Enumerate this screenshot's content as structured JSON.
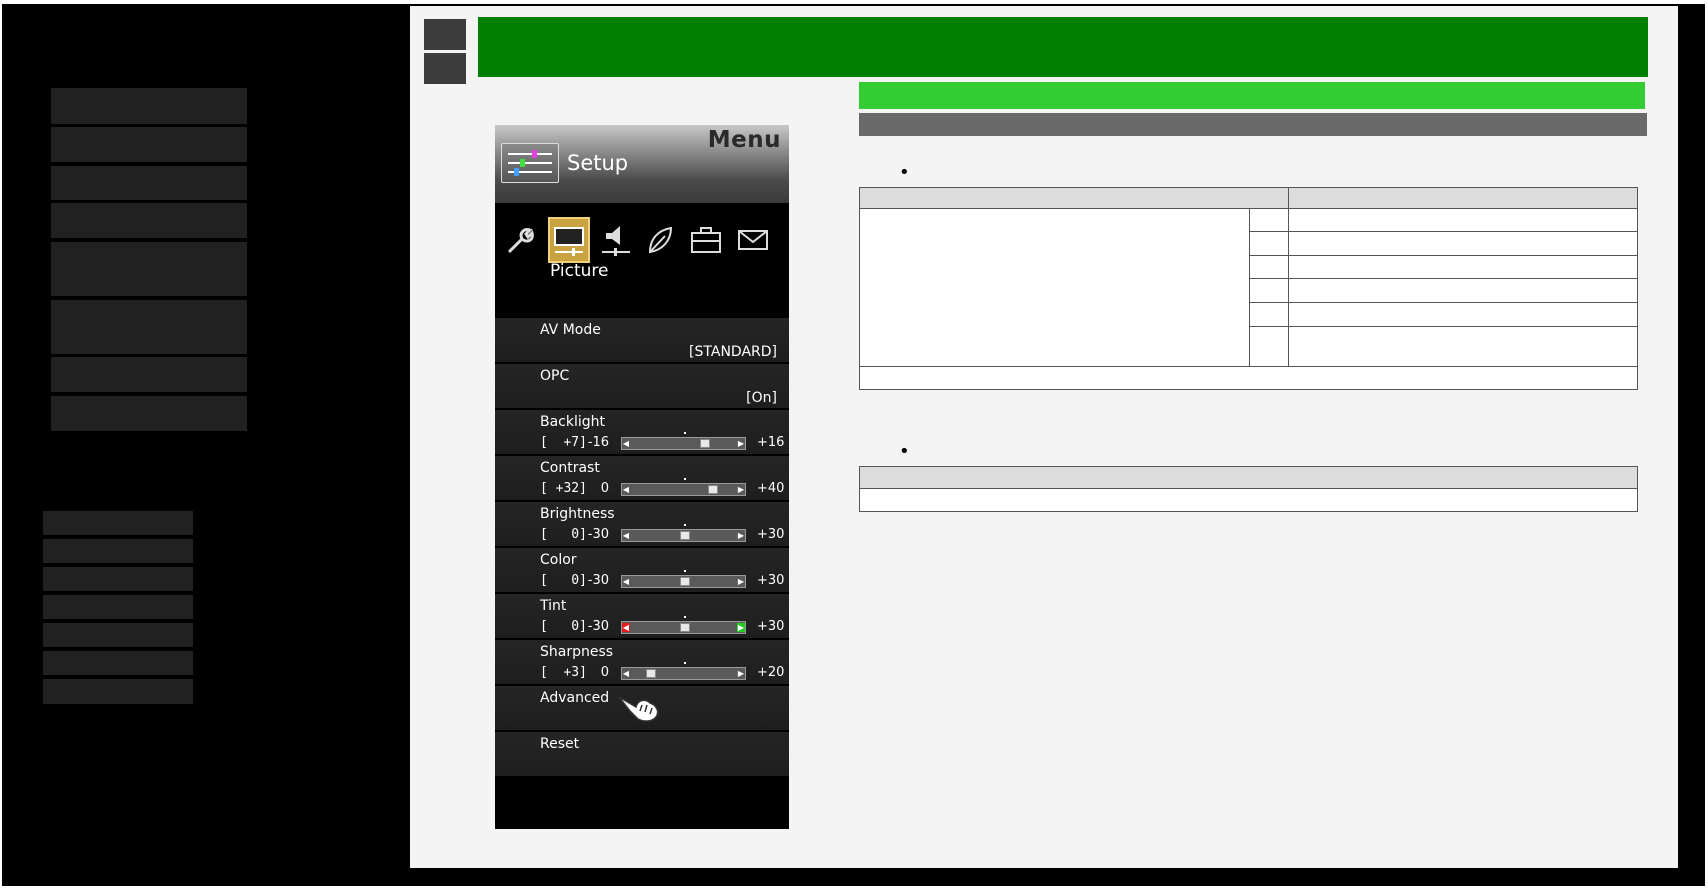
{
  "tv_menu": {
    "header_title": "Menu",
    "section_title": "Setup",
    "category_icons": [
      "wrench-icon",
      "picture-icon",
      "speaker-icon",
      "leaf-icon",
      "briefcase-icon",
      "envelope-icon"
    ],
    "selected_category": "Picture",
    "rows": [
      {
        "name": "AV Mode",
        "value": "[STANDARD]"
      },
      {
        "name": "OPC",
        "value": "[On]"
      }
    ],
    "sliders": [
      {
        "name": "Backlight",
        "current": "[  +7]",
        "min": "-16",
        "max": "+16",
        "value": 7,
        "lo": -16,
        "hi": 16
      },
      {
        "name": "Contrast",
        "current": "[ +32]",
        "min": "0",
        "max": "+40",
        "value": 32,
        "lo": 0,
        "hi": 40
      },
      {
        "name": "Brightness",
        "current": "[   0]",
        "min": "-30",
        "max": "+30",
        "value": 0,
        "lo": -30,
        "hi": 30
      },
      {
        "name": "Color",
        "current": "[   0]",
        "min": "-30",
        "max": "+30",
        "value": 0,
        "lo": -30,
        "hi": 30
      },
      {
        "name": "Tint",
        "current": "[   0]",
        "min": "-30",
        "max": "+30",
        "value": 0,
        "lo": -30,
        "hi": 30
      },
      {
        "name": "Sharpness",
        "current": "[  +3]",
        "min": "0",
        "max": "+20",
        "value": 3,
        "lo": 0,
        "hi": 20
      }
    ],
    "advanced_label": "Advanced",
    "reset_label": "Reset"
  },
  "colors": {
    "title_bar": "#008000",
    "section_bar": "#33cc33",
    "sub_bar": "#6a6a6a",
    "sidebar_block": "#212121",
    "selected_icon": "#c9a341"
  },
  "bullets": [
    "•",
    "•"
  ]
}
